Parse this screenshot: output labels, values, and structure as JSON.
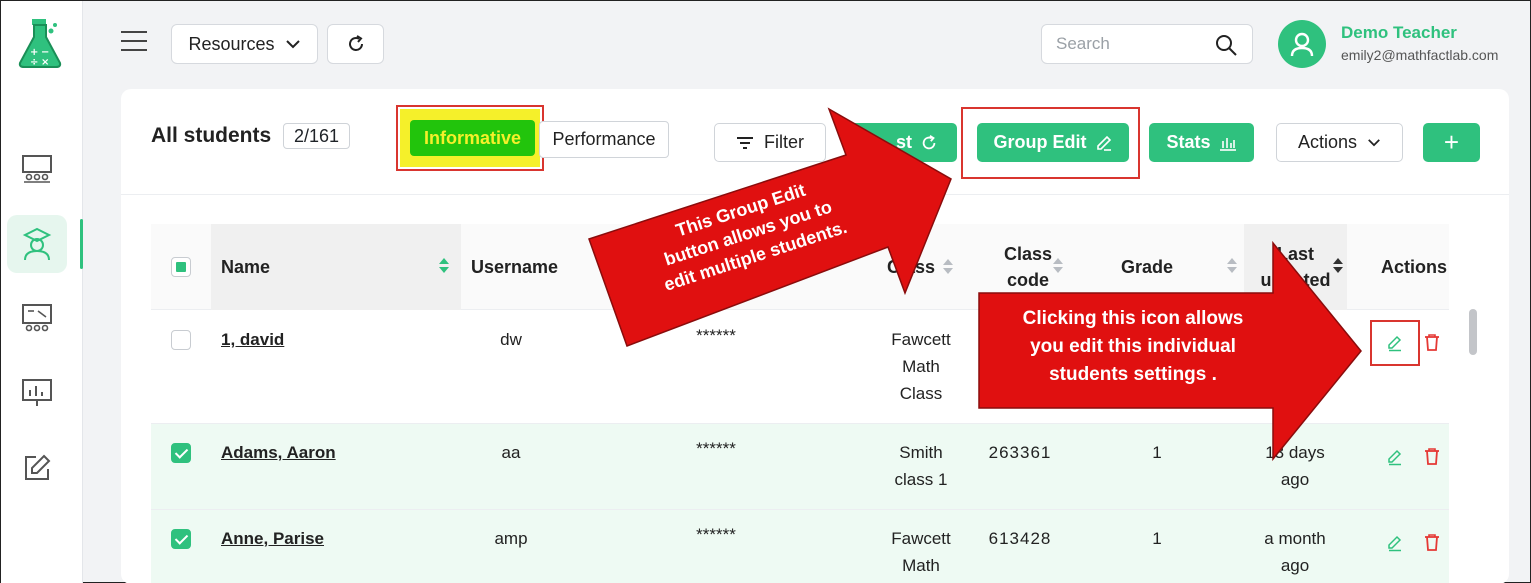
{
  "header": {
    "resources_label": "Resources",
    "search_placeholder": "Search",
    "user_name": "Demo Teacher",
    "user_email": "emily2@mathfactlab.com"
  },
  "sidebar": {
    "items": [
      "classroom",
      "students",
      "assignments",
      "reports",
      "edit"
    ],
    "active": "students"
  },
  "card": {
    "title": "All students",
    "count": "2/161",
    "informative_label": "Informative",
    "performance_label": "Performance",
    "filter_label": "Filter",
    "reset_partial": "st",
    "group_edit_label": "Group Edit",
    "stats_label": "Stats",
    "actions_label": "Actions",
    "add_label": "+"
  },
  "table": {
    "headers": {
      "name": "Name",
      "username": "Username",
      "class": "Class",
      "class_code_1": "Class",
      "class_code_2": "code",
      "grade": "Grade",
      "last_1": "Last",
      "last_2": "updated",
      "actions": "Actions"
    },
    "rows": [
      {
        "name": "1, david",
        "username": "dw",
        "password": "******",
        "class_1": "Fawcett",
        "class_2": "Math",
        "class_3": "Class",
        "code": "",
        "grade": "",
        "last_1": "",
        "last_2": "",
        "selected": false
      },
      {
        "name": "Adams, Aaron",
        "username": "aa",
        "password": "******",
        "class_1": "Smith",
        "class_2": "class 1",
        "class_3": "",
        "code": "263361",
        "grade": "1",
        "last_1": "13 days",
        "last_2": "ago",
        "selected": true
      },
      {
        "name": "Anne, Parise",
        "username": "amp",
        "password": "******",
        "class_1": "Fawcett",
        "class_2": "Math",
        "class_3": "",
        "code": "613428",
        "grade": "1",
        "last_1": "a month",
        "last_2": "ago",
        "selected": true
      }
    ]
  },
  "annotations": {
    "group_edit_callout": "This Group Edit\nbutton allows you to\nedit multiple students.",
    "icon_callout": "Clicking this icon allows\nyou edit this individual\nstudents settings ."
  },
  "colors": {
    "brand_green": "#2fc17e",
    "informative_green": "#22c40c",
    "highlight_yellow": "#f5f02a",
    "annotation_red": "#e01010",
    "delete_red": "#e53935"
  }
}
